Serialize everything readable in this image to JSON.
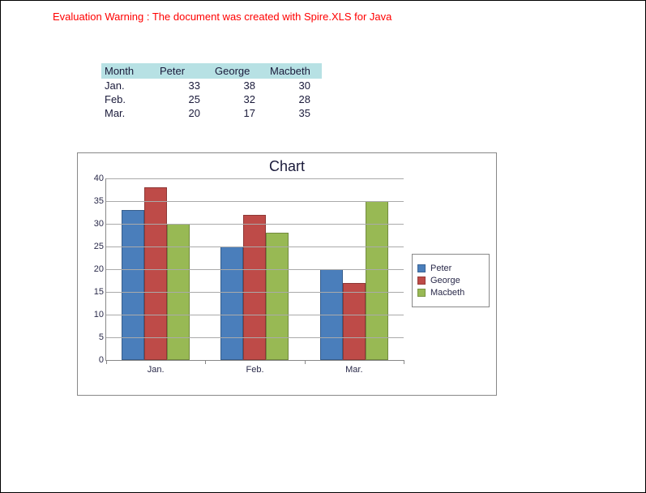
{
  "warning_text": "Evaluation Warning : The document was created with  Spire.XLS for Java",
  "table": {
    "headers": [
      "Month",
      "Peter",
      "George",
      "Macbeth"
    ],
    "rows": [
      {
        "label": "Jan.",
        "values": [
          33,
          38,
          30
        ]
      },
      {
        "label": "Feb.",
        "values": [
          25,
          32,
          28
        ]
      },
      {
        "label": "Mar.",
        "values": [
          20,
          17,
          35
        ]
      }
    ]
  },
  "chart_data": {
    "type": "bar",
    "title": "Chart",
    "categories": [
      "Jan.",
      "Feb.",
      "Mar."
    ],
    "series": [
      {
        "name": "Peter",
        "color": "#4a7ebb",
        "values": [
          33,
          25,
          20
        ]
      },
      {
        "name": "George",
        "color": "#be4b48",
        "values": [
          38,
          32,
          17
        ]
      },
      {
        "name": "Macbeth",
        "color": "#98b954",
        "values": [
          30,
          28,
          35
        ]
      }
    ],
    "y_ticks": [
      0,
      5,
      10,
      15,
      20,
      25,
      30,
      35,
      40
    ],
    "ylim": [
      0,
      40
    ],
    "xlabel": "",
    "ylabel": ""
  }
}
